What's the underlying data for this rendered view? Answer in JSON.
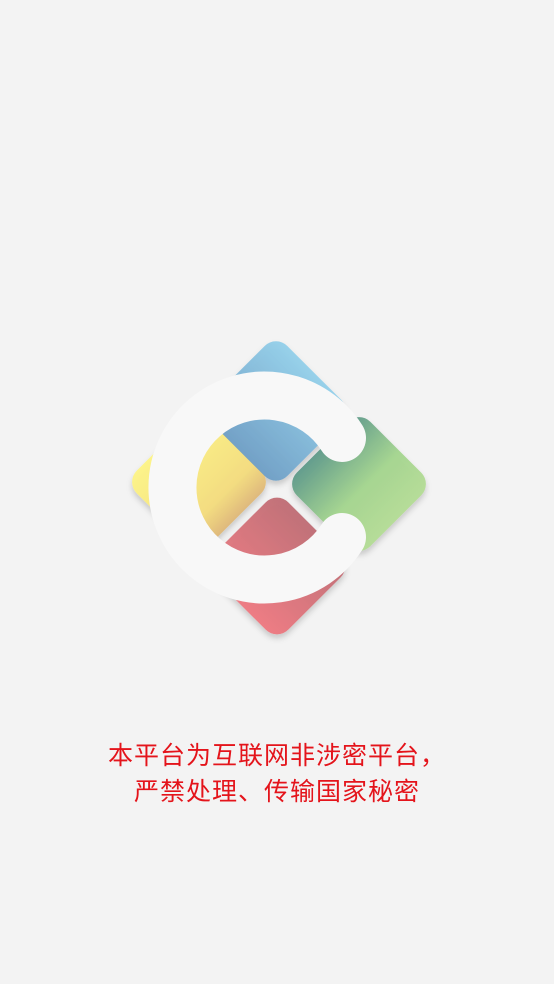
{
  "splash": {
    "logo_icon": "colorful-diamond-c-logo-icon",
    "colors": {
      "blue": "#8fc9e7",
      "green": "#a8d88f",
      "yellow": "#fbf082",
      "red": "#ec7b86",
      "notice_text": "#e4141b",
      "background": "#f3f3f3"
    },
    "notice_line_1": "本平台为互联网非涉密平台，",
    "notice_line_2": "严禁处理、传输国家秘密"
  }
}
